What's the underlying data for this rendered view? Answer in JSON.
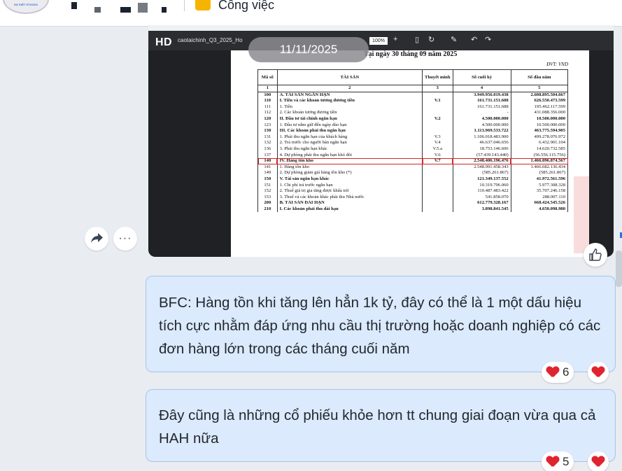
{
  "header": {
    "folder_label": "Công việc",
    "avatar_text": "SỰ KIỆT STOCKS"
  },
  "image_message": {
    "hd_badge": "HD",
    "file_name": "caotaichinh_Q3_2025_Ho",
    "date_label": "11/11/2025",
    "zoom": "100%",
    "pdf": {
      "heading": "Tại ngày 30 tháng 09 năm 2025",
      "unit": "ĐVT: VND",
      "columns": [
        "Mã số",
        "TÀI SẢN",
        "Thuyết minh",
        "Số cuối kỳ",
        "Số đầu năm"
      ],
      "index_row": [
        "1",
        "2",
        "3",
        "4",
        "5"
      ],
      "rows": [
        {
          "code": "100",
          "name": "A.  TÀI SẢN NGẮN HẠN",
          "note": "",
          "end": "3.949.956.019.438",
          "start": "2.608.895.504.667",
          "bold": true
        },
        {
          "code": "110",
          "name": "I.   Tiền và các khoản tương đương tiền",
          "note": "V.1",
          "end": "161.731.151.688",
          "start": "626.550.473.599",
          "bold": true
        },
        {
          "code": "111",
          "name": "1.  Tiền",
          "note": "",
          "end": "161.731.151.688",
          "start": "195.462.117.599",
          "bold": false
        },
        {
          "code": "112",
          "name": "2.  Các khoản tương đương tiền",
          "note": "",
          "end": "-",
          "start": "431.088.356.000",
          "bold": false
        },
        {
          "code": "120",
          "name": "II.  Đầu tư tài chính ngắn hạn",
          "note": "V.2",
          "end": "4.500.000.000",
          "start": "10.500.000.000",
          "bold": true
        },
        {
          "code": "123",
          "name": "1.  Đầu tư nắm giữ đến ngày đáo hạn",
          "note": "",
          "end": "4.500.000.000",
          "start": "10.500.000.000",
          "bold": false
        },
        {
          "code": "130",
          "name": "III. Các khoản phải thu ngắn hạn",
          "note": "",
          "end": "1.113.969.533.722",
          "start": "463.775.594.905",
          "bold": true
        },
        {
          "code": "131",
          "name": "1.  Phải thu ngắn hạn của khách hàng",
          "note": "V.3",
          "end": "1.106.018.483.900",
          "start": "499.278.076.972",
          "bold": false
        },
        {
          "code": "132",
          "name": "2.  Trả trước cho người bán ngắn hạn",
          "note": "V.4",
          "end": "46.637.046.656",
          "start": "6.432.901.104",
          "bold": false
        },
        {
          "code": "136",
          "name": "3.  Phải thu ngắn hạn khác",
          "note": "V.5.a",
          "end": "18.753.146.606",
          "start": "14.620.732.585",
          "bold": false
        },
        {
          "code": "137",
          "name": "4.  Dự phòng phải thu ngắn hạn khó đòi",
          "note": "V.6",
          "end": "(57.439.143.440)",
          "start": "(56.556.115.756)",
          "bold": false
        },
        {
          "code": "140",
          "name": "IV. Hàng tồn kho",
          "note": "V.7",
          "end": "2.548.406.196.476",
          "start": "1.466.096.874.567",
          "bold": true,
          "highlight": true
        },
        {
          "code": "141",
          "name": "1.  Hàng tồn kho",
          "note": "",
          "end": "2.548.991.458.343",
          "start": "1.466.682.136.434",
          "bold": false
        },
        {
          "code": "149",
          "name": "2.  Dự phòng giảm giá hàng tồn kho (*)",
          "note": "",
          "end": "(585.261.867)",
          "start": "(585.261.867)",
          "bold": false
        },
        {
          "code": "150",
          "name": "V.  Tài sản ngắn hạn khác",
          "note": "",
          "end": "121.349.137.552",
          "start": "41.972.561.596",
          "bold": true
        },
        {
          "code": "151",
          "name": "1.  Chi phí trả trước ngắn hạn",
          "note": "",
          "end": "10.319.796.060",
          "start": "5.977.308.328",
          "bold": false
        },
        {
          "code": "152",
          "name": "2.  Thuế giá trị gia tăng được khấu trừ",
          "note": "",
          "end": "110.487.483.422",
          "start": "35.707.246.158",
          "bold": false
        },
        {
          "code": "153",
          "name": "3.  Thuế và các khoản khác phải thu Nhà nước",
          "note": "",
          "end": "541.858.070",
          "start": "288.007.110",
          "bold": false
        },
        {
          "code": "200",
          "name": "B.  TÀI SẢN DÀI HẠN",
          "note": "",
          "end": "612.779.328.167",
          "start": "668.424.545.526",
          "bold": true
        },
        {
          "code": "210",
          "name": "I.   Các khoản phải thu dài hạn",
          "note": "",
          "end": "3.898.841.545",
          "start": "4.650.098.980",
          "bold": true
        }
      ]
    }
  },
  "messages": [
    {
      "text": "BFC: Hàng tồn khi tăng lên hẳn 1k tỷ, đây có thể là 1 một dấu hiệu tích cực nhằm đáp ứng nhu cầu thị trường hoặc doanh nghiệp có các đơn hàng lớn trong các tháng cuối năm",
      "reaction_count": "6"
    },
    {
      "text": "Đây cũng là những cổ phiếu khỏe hơn tt chung giai đoạn vừa qua cả HAH nữa",
      "reaction_count": "5"
    }
  ],
  "icons": {
    "share": "share-icon",
    "more": "more-icon",
    "like": "thumbs-up-icon",
    "heart": "heart-icon",
    "folder": "folder-icon"
  },
  "colors": {
    "bubble_bg": "#dbeafc",
    "bubble_border": "#a7c4e8",
    "heart": "#e0242f",
    "highlight_box": "#d6242a",
    "background": "#e9edf1"
  }
}
